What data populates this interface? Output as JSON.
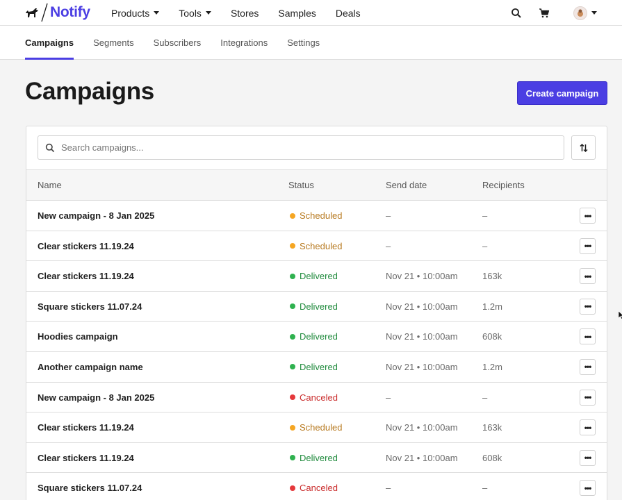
{
  "header": {
    "brand": "Notify",
    "nav": [
      {
        "label": "Products",
        "has_dropdown": true
      },
      {
        "label": "Tools",
        "has_dropdown": true
      },
      {
        "label": "Stores",
        "has_dropdown": false
      },
      {
        "label": "Samples",
        "has_dropdown": false
      },
      {
        "label": "Deals",
        "has_dropdown": false
      }
    ],
    "icons": [
      "search-icon",
      "cart-icon",
      "avatar-dropdown"
    ]
  },
  "subnav": {
    "tabs": [
      {
        "label": "Campaigns",
        "active": true
      },
      {
        "label": "Segments",
        "active": false
      },
      {
        "label": "Subscribers",
        "active": false
      },
      {
        "label": "Integrations",
        "active": false
      },
      {
        "label": "Settings",
        "active": false
      }
    ]
  },
  "page": {
    "title": "Campaigns",
    "create_button": "Create campaign"
  },
  "search": {
    "placeholder": "Search campaigns...",
    "value": ""
  },
  "table": {
    "columns": {
      "name": "Name",
      "status": "Status",
      "send_date": "Send date",
      "recipients": "Recipients"
    },
    "rows": [
      {
        "name": "New campaign - 8 Jan 2025",
        "status": "Scheduled",
        "send_date": "–",
        "recipients": "–"
      },
      {
        "name": "Clear stickers 11.19.24",
        "status": "Scheduled",
        "send_date": "–",
        "recipients": "–"
      },
      {
        "name": "Clear stickers 11.19.24",
        "status": "Delivered",
        "send_date": "Nov 21 • 10:00am",
        "recipients": "163k"
      },
      {
        "name": "Square stickers 11.07.24",
        "status": "Delivered",
        "send_date": "Nov 21 • 10:00am",
        "recipients": "1.2m"
      },
      {
        "name": "Hoodies campaign",
        "status": "Delivered",
        "send_date": "Nov 21 • 10:00am",
        "recipients": "608k"
      },
      {
        "name": "Another campaign name",
        "status": "Delivered",
        "send_date": "Nov 21 • 10:00am",
        "recipients": "1.2m"
      },
      {
        "name": "New campaign - 8 Jan 2025",
        "status": "Canceled",
        "send_date": "–",
        "recipients": "–"
      },
      {
        "name": "Clear stickers 11.19.24",
        "status": "Scheduled",
        "send_date": "Nov 21 • 10:00am",
        "recipients": "163k"
      },
      {
        "name": "Clear stickers 11.19.24",
        "status": "Delivered",
        "send_date": "Nov 21 • 10:00am",
        "recipients": "608k"
      },
      {
        "name": "Square stickers 11.07.24",
        "status": "Canceled",
        "send_date": "–",
        "recipients": "–"
      }
    ]
  },
  "status_colors": {
    "Scheduled": {
      "dot": "#f5a623",
      "text": "#b7791f"
    },
    "Delivered": {
      "dot": "#2fb14f",
      "text": "#1f8a3c"
    },
    "Canceled": {
      "dot": "#e5383b",
      "text": "#c92a2a"
    }
  },
  "colors": {
    "accent": "#4b3ee3"
  }
}
